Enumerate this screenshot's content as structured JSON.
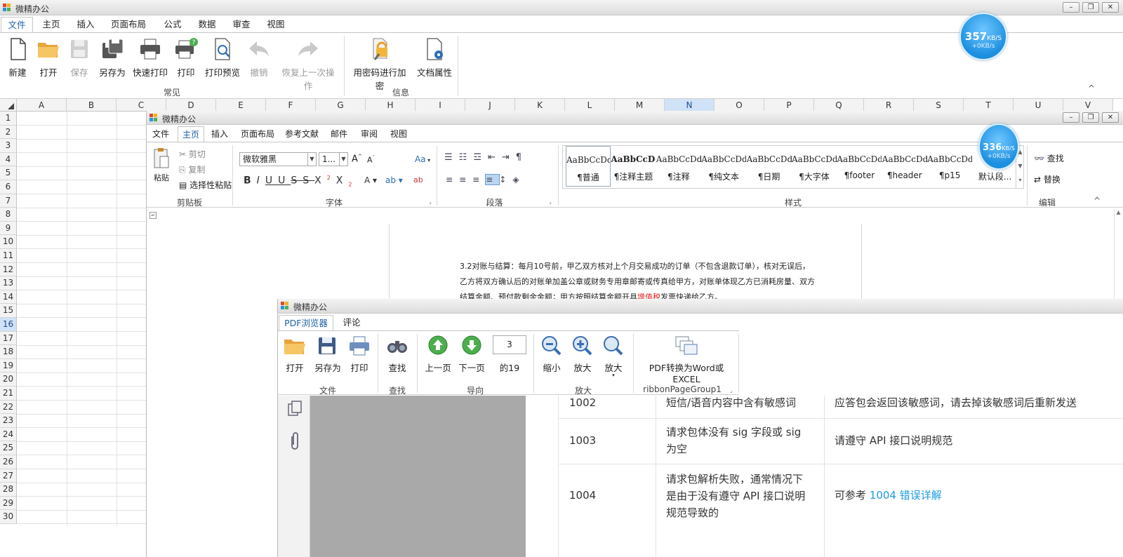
{
  "colors": {
    "accent": "#1f5fa8",
    "selected_header": "#cfe2f7",
    "bubble": "#1d8fe0",
    "link": "#1a9be0",
    "highlight_text": "#e02020"
  },
  "excel": {
    "title": "微精办公",
    "window_controls": [
      "–",
      "❐",
      "✕"
    ],
    "tabs": [
      "文件",
      "主页",
      "插入",
      "页面布局",
      "公式",
      "数据",
      "审查",
      "视图"
    ],
    "buttons": [
      {
        "label": "新建",
        "icon": "new-document-icon"
      },
      {
        "label": "打开",
        "icon": "open-folder-icon"
      },
      {
        "label": "保存",
        "icon": "save-icon"
      },
      {
        "label": "另存为",
        "icon": "save-as-icon"
      },
      {
        "label": "快速打印",
        "icon": "quick-print-icon"
      },
      {
        "label": "打印",
        "icon": "print-icon"
      },
      {
        "label": "打印预览",
        "icon": "print-preview-icon"
      },
      {
        "label": "撤销",
        "icon": "undo-icon"
      },
      {
        "label": "恢复上一次操作",
        "icon": "redo-icon"
      },
      {
        "label": "用密码进行加密",
        "icon": "encrypt-icon"
      },
      {
        "label": "文档属性",
        "icon": "doc-properties-icon"
      }
    ],
    "groups": [
      "常见",
      "信息"
    ],
    "columns": [
      "A",
      "B",
      "C",
      "D",
      "E",
      "F",
      "G",
      "H",
      "I",
      "J",
      "K",
      "L",
      "M",
      "N",
      "O",
      "P",
      "Q",
      "R",
      "S",
      "T",
      "U",
      "V"
    ],
    "selected_column": "N",
    "rows": [
      "1",
      "2",
      "3",
      "4",
      "5",
      "6",
      "7",
      "8",
      "9",
      "10",
      "11",
      "12",
      "13",
      "14",
      "15",
      "16",
      "17",
      "18",
      "19",
      "20",
      "21",
      "22",
      "23",
      "24",
      "25",
      "26",
      "27",
      "28",
      "29",
      "30"
    ],
    "selected_row": "16",
    "speed": {
      "value": "357",
      "unit": "KB/S",
      "sub": "+0KB/s"
    },
    "collapse": "^"
  },
  "word": {
    "title": "微精办公",
    "window_controls": [
      "–",
      "❐",
      "✕"
    ],
    "tabs": [
      "文件",
      "主页",
      "插入",
      "页面布局",
      "参考文献",
      "邮件",
      "审阅",
      "视图"
    ],
    "clipboard": {
      "paste": "粘贴",
      "cut": "剪切",
      "copy": "复制",
      "paste_special": "选择性粘贴",
      "group": "剪贴板"
    },
    "font": {
      "name": "微软雅黑",
      "size": "1...",
      "group": "字体",
      "case": "Aa"
    },
    "paragraph_group": "段落",
    "styles": [
      {
        "sample": "AaBbCcDdE",
        "name": "¶普通"
      },
      {
        "sample": "AaBbCcDd",
        "name": "¶注释主题"
      },
      {
        "sample": "AaBbCcDdE",
        "name": "¶注释"
      },
      {
        "sample": "AaBbCcDdEe",
        "name": "¶纯文本"
      },
      {
        "sample": "AaBbCcDdE",
        "name": "¶日期"
      },
      {
        "sample": "AaBbCcDdEe",
        "name": "¶大字体"
      },
      {
        "sample": "AaBbCcDdEe",
        "name": "¶footer"
      },
      {
        "sample": "AaBbCcDdEe",
        "name": "¶header"
      },
      {
        "sample": "AaBbCcDdE",
        "name": "¶p15"
      },
      {
        "sample": "AaBb",
        "name": "默认段..."
      }
    ],
    "styles_group": "样式",
    "editing": {
      "find": "查找",
      "replace": "替换",
      "group": "编辑"
    },
    "speed": {
      "value": "336",
      "unit": "KB/S",
      "sub": "+0KB/s"
    },
    "doc_lines": {
      "line1": "3.2对账与结算：每月10号前，甲乙双方核对上个月交易成功的订单（不包含退款订单），核对无误后，",
      "line2": "乙方将双方确认后的对账单加盖公章或财务专用章邮寄或传真给甲方，对账单体现乙方已消耗房量、双方",
      "line3a": "结算金额、预付款剩余金额；甲方按照结算金额开具",
      "line3b": "增值税",
      "line3c": "发票快递给乙方。"
    }
  },
  "pdf": {
    "title": "微精办公",
    "tabs": [
      "PDF浏览器",
      "评论"
    ],
    "buttons": {
      "open": "打开",
      "save_as": "另存为",
      "print": "打印",
      "find": "查找",
      "prev": "上一页",
      "next": "下一页",
      "page": "3",
      "page_total": "的19",
      "zoom_out": "缩小",
      "zoom_in": "放大",
      "zoom_menu": "放大",
      "convert": "PDF转换为Word或EXCEL"
    },
    "groups": {
      "file": "文件",
      "find": "查找",
      "nav": "导向",
      "zoom": "放大",
      "extra": "ribbonPageGroup1"
    },
    "table": [
      {
        "code": "1002",
        "desc": [
          "短信/语音内容中含有敏感词"
        ],
        "solution": "应答包会返回该敏感词，请去掉该敏感词后重新发送"
      },
      {
        "code": "1003",
        "desc": [
          "请求包体没有 sig 字段或 sig",
          "为空"
        ],
        "solution": "请遵守 API 接口说明规范"
      },
      {
        "code": "1004",
        "desc": [
          "请求包解析失败，通常情况下",
          "是由于没有遵守 API 接口说明",
          "规范导致的"
        ],
        "solution_prefix": "可参考 ",
        "solution_link": "1004 错误详解"
      }
    ]
  }
}
